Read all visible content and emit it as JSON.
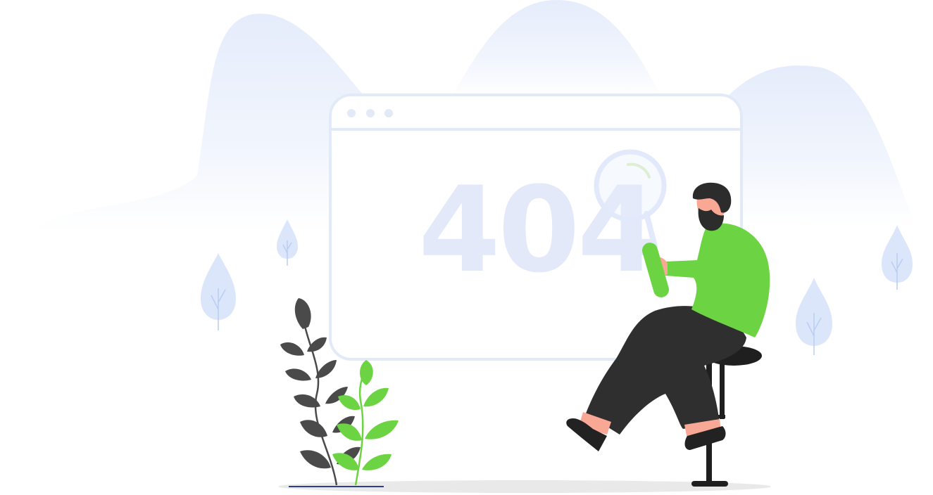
{
  "illustration": {
    "error_code": "404",
    "colors": {
      "background": "#ffffff",
      "hills": "#e6ecfb",
      "window_frame": "#e3eaf7",
      "error_text": "#e3e9f9",
      "magnifier": "#e2e9fa",
      "sweater": "#6cd443",
      "pants": "#2f2f2f",
      "skin": "#f8a895",
      "hair": "#2c2c2c",
      "leaf_dark": "#4a4a4a",
      "leaf_green": "#6cd443",
      "bush_light": "#dce6fb",
      "ground": "#e6e6e6"
    }
  }
}
